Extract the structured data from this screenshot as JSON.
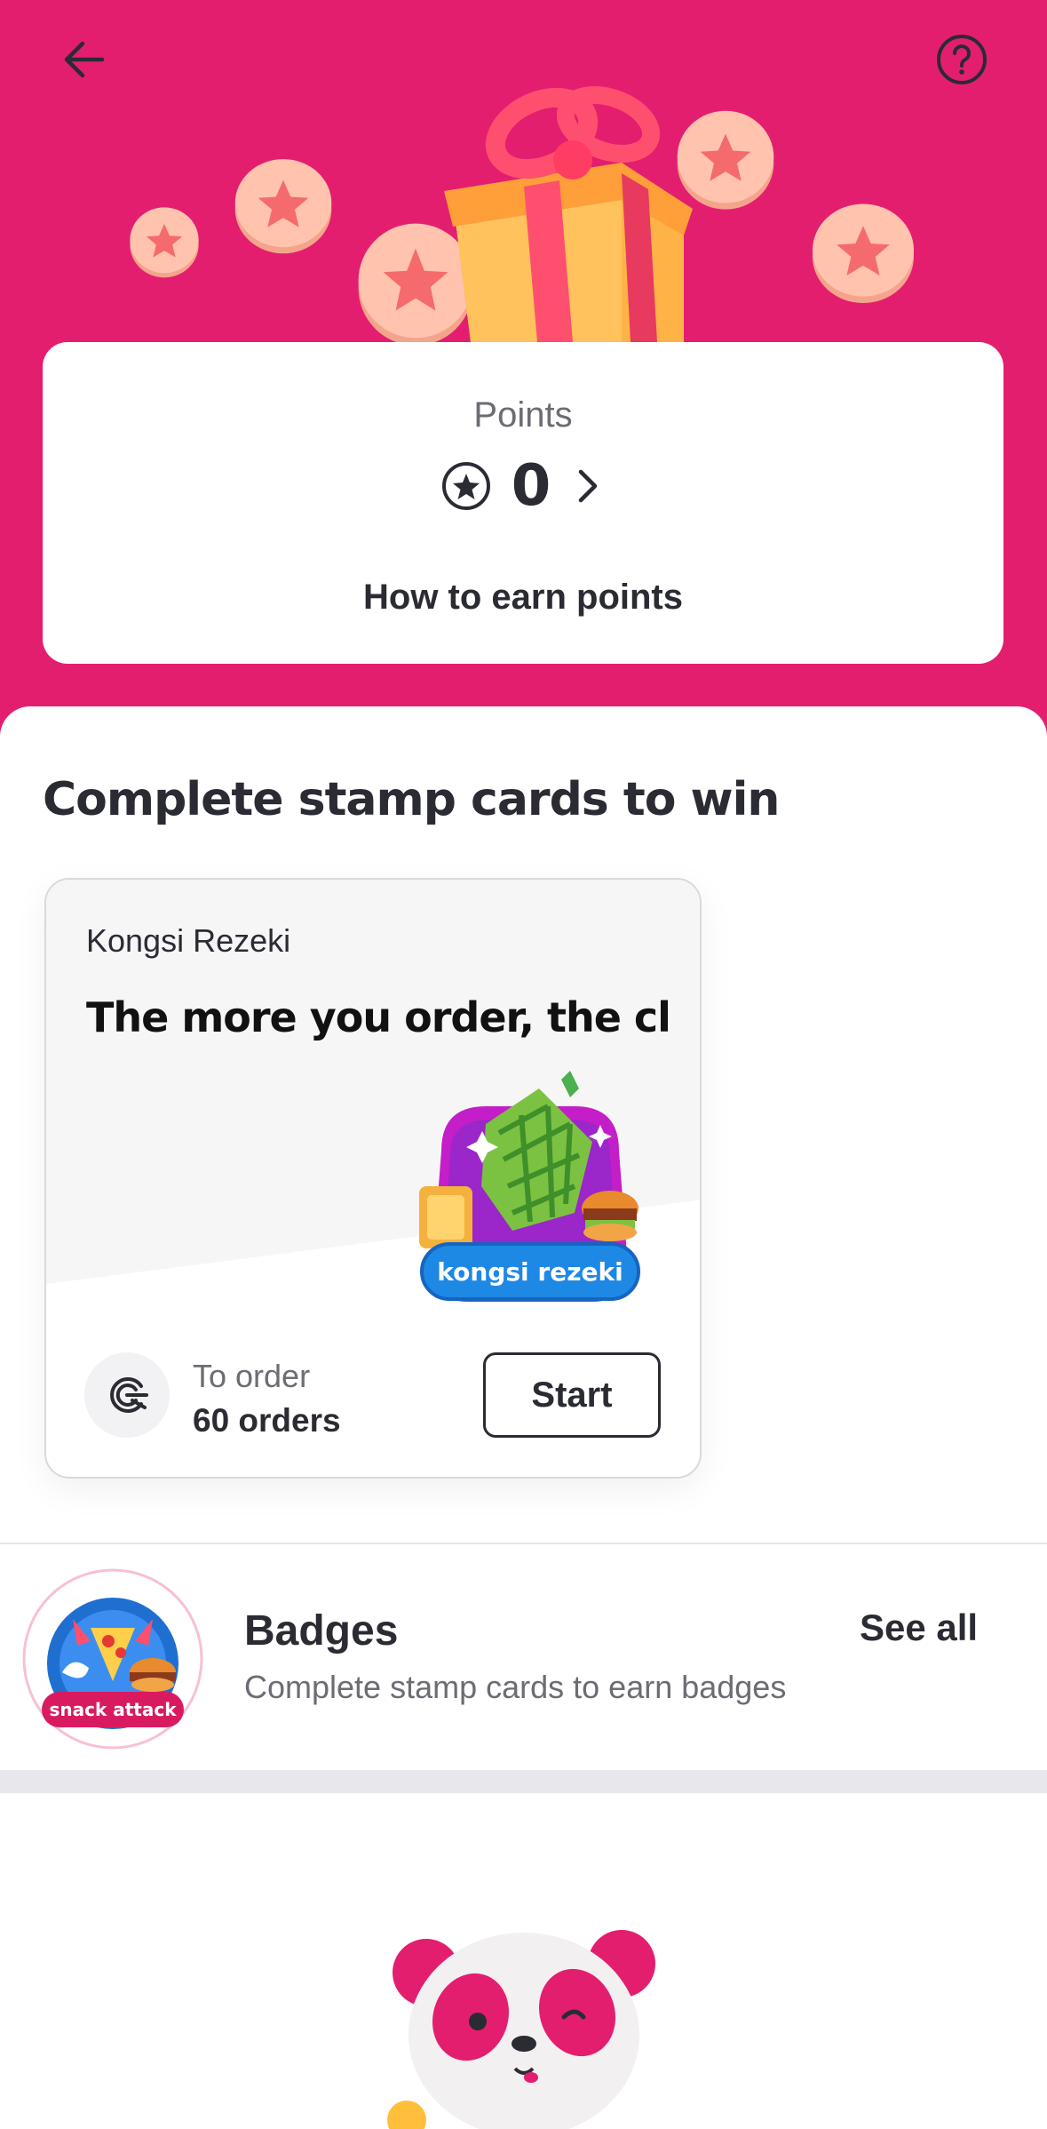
{
  "header": {
    "back_icon": "arrow-left-icon",
    "help_icon": "question-circle-icon"
  },
  "colors": {
    "brand": "#e41e6f",
    "text": "#2a2b33",
    "muted": "#6b6c74",
    "coin": "#ffbca6"
  },
  "points": {
    "label": "Points",
    "value": "0",
    "how_to_earn": "How to earn points"
  },
  "stamp_section": {
    "title": "Complete stamp cards to win",
    "card": {
      "campaign_name": "Kongsi Rezeki",
      "headline": "The more you order, the cl...",
      "badge_text": "kongsi rezeki",
      "order_label": "To order",
      "order_value": "60 orders",
      "start_label": "Start"
    }
  },
  "badges": {
    "title": "Badges",
    "subtitle": "Complete stamp cards to earn badges",
    "see_all": "See all",
    "badge_text": "snack attack"
  }
}
